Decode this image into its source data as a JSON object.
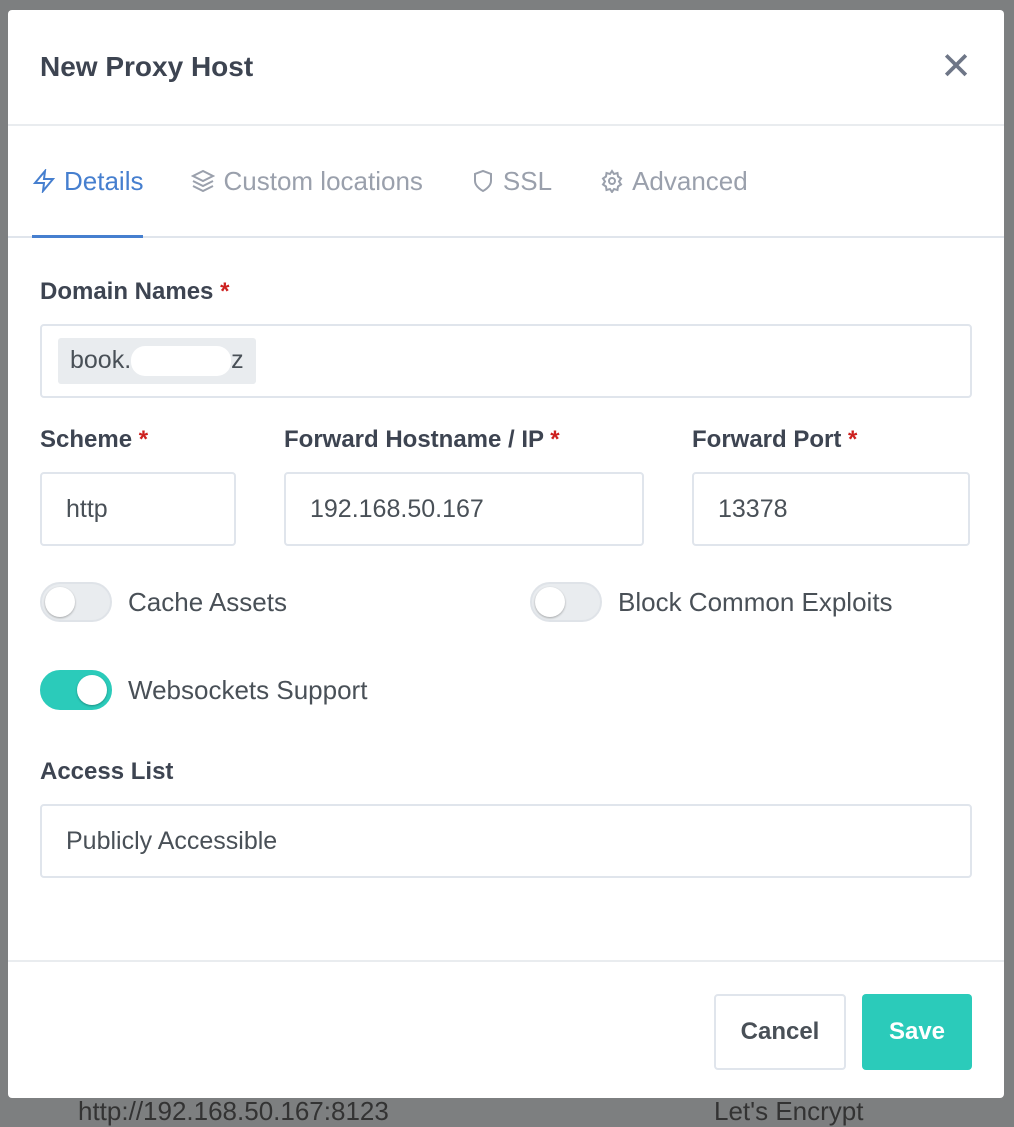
{
  "background": {
    "forward_url": "http://192.168.50.167:8123",
    "ssl": "Let's Encrypt"
  },
  "modal": {
    "title": "New Proxy Host",
    "tabs": [
      {
        "label": "Details",
        "icon": "lightning-icon"
      },
      {
        "label": "Custom locations",
        "icon": "layers-icon"
      },
      {
        "label": "SSL",
        "icon": "shield-icon"
      },
      {
        "label": "Advanced",
        "icon": "gear-icon"
      }
    ],
    "domain_names": {
      "label": "Domain Names",
      "required": "*",
      "chip_start": "book.",
      "chip_end": "z"
    },
    "scheme": {
      "label": "Scheme",
      "required": "*",
      "value": "http"
    },
    "forward_host": {
      "label": "Forward Hostname / IP",
      "required": "*",
      "value": "192.168.50.167"
    },
    "forward_port": {
      "label": "Forward Port",
      "required": "*",
      "value": "13378"
    },
    "toggles": {
      "cache_assets": {
        "label": "Cache Assets",
        "on": false
      },
      "block_exploits": {
        "label": "Block Common Exploits",
        "on": false
      },
      "websockets": {
        "label": "Websockets Support",
        "on": true
      }
    },
    "access_list": {
      "label": "Access List",
      "value": "Publicly Accessible"
    },
    "cancel": "Cancel",
    "save": "Save",
    "colors": {
      "accent": "#467fcf",
      "teal": "#2bcbba",
      "required": "#cd201f"
    }
  }
}
